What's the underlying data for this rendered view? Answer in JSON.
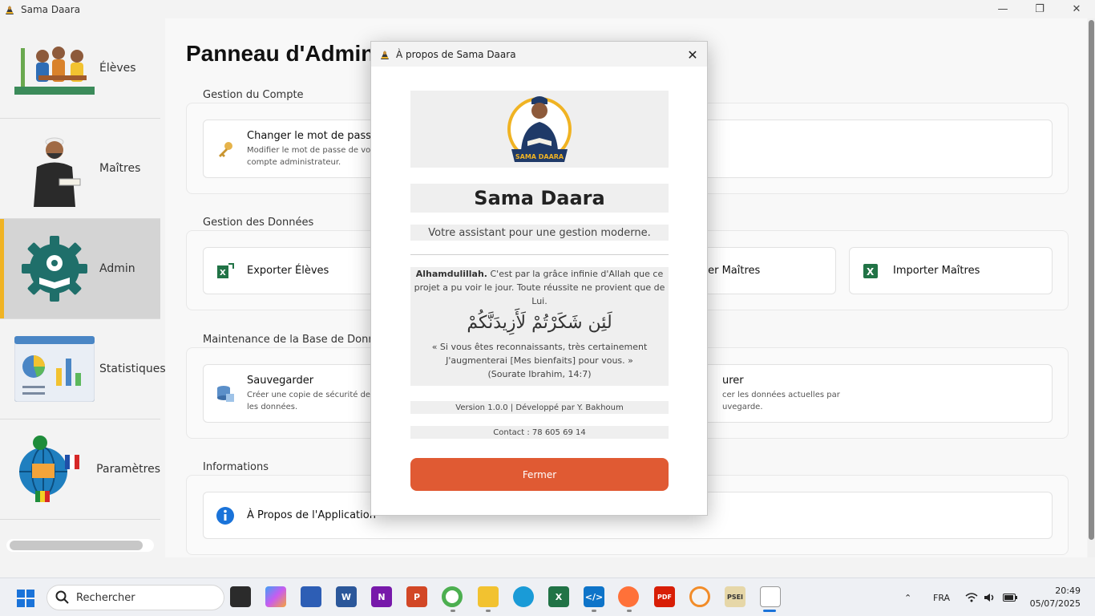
{
  "window": {
    "title": "Sama Daara",
    "minimize_icon": "minimize-icon",
    "maximize_icon": "restore-icon",
    "close_icon": "close-icon"
  },
  "sidebar": {
    "items": [
      {
        "label": "Élèves",
        "icon": "students-illustration"
      },
      {
        "label": "Maîtres",
        "icon": "teacher-illustration"
      },
      {
        "label": "Admin",
        "icon": "admin-gear-illustration",
        "active": true
      },
      {
        "label": "Statistiques",
        "icon": "statistics-illustration"
      },
      {
        "label": "Paramètres",
        "icon": "settings-globe-illustration"
      }
    ]
  },
  "main": {
    "title": "Panneau d'Administration",
    "sections": {
      "account": {
        "label": "Gestion du Compte",
        "change_password": {
          "title": "Changer le mot de passe",
          "desc1": "Modifier le mot de passe de votre",
          "desc2": "compte administrateur."
        }
      },
      "data": {
        "label": "Gestion des Données",
        "export_students": "Exporter Élèves",
        "export_masters_partial": "ter Maîtres",
        "import_masters": "Importer Maîtres"
      },
      "maintenance": {
        "label": "Maintenance de la Base de Données",
        "backup": {
          "title": "Sauvegarder",
          "desc1": "Créer une copie de sécurité de",
          "desc2": "les données."
        },
        "restore": {
          "title_partial": "urer",
          "desc1_partial": "cer les données actuelles par",
          "desc2_partial": "uvegarde."
        }
      },
      "info": {
        "label": "Informations",
        "about": "À Propos de l'Application"
      }
    }
  },
  "dialog": {
    "title": "À propos de Sama Daara",
    "logo_text": "SAMA DAARA",
    "app_name": "Sama Daara",
    "tagline": "Votre assistant pour une gestion moderne.",
    "quote_bold": "Alhamdulillah.",
    "quote_text": "C'est par la grâce infinie d'Allah que ce projet a pu voir le jour. Toute réussite ne provient que de Lui.",
    "arabic_verse": "لَئِن شَكَرْتُمْ لَأَزِيدَنَّكُمْ",
    "translation": "« Si vous êtes reconnaissants, très certainement J'augmenterai [Mes bienfaits] pour vous. »",
    "reference": "(Sourate Ibrahim, 14:7)",
    "version": "Version 1.0.0 | Développé par Y. Bakhoum",
    "contact": "Contact : 78 605 69 14",
    "close_label": "Fermer"
  },
  "taskbar": {
    "search_placeholder": "Rechercher",
    "language": "FRA",
    "time": "20:49",
    "date": "05/07/2025",
    "apps": [
      "file-explorer-taskview",
      "copilot",
      "notepad",
      "word",
      "onenote",
      "powerpoint",
      "chrome",
      "file-explorer",
      "edge",
      "excel",
      "vscode",
      "firefox",
      "pdf-reader",
      "eclipse",
      "ipsei",
      "blank-document"
    ],
    "accent_colors": {
      "word": "#2b579a",
      "onenote": "#7719aa",
      "powerpoint": "#d24726",
      "excel": "#217346",
      "vscode": "#0e74c9",
      "pdf": "#d81e06"
    }
  },
  "colors": {
    "active_accent": "#f0b323",
    "close_button": "#e05a33",
    "logo_navy": "#1f3a68",
    "logo_gold": "#f0b323"
  }
}
